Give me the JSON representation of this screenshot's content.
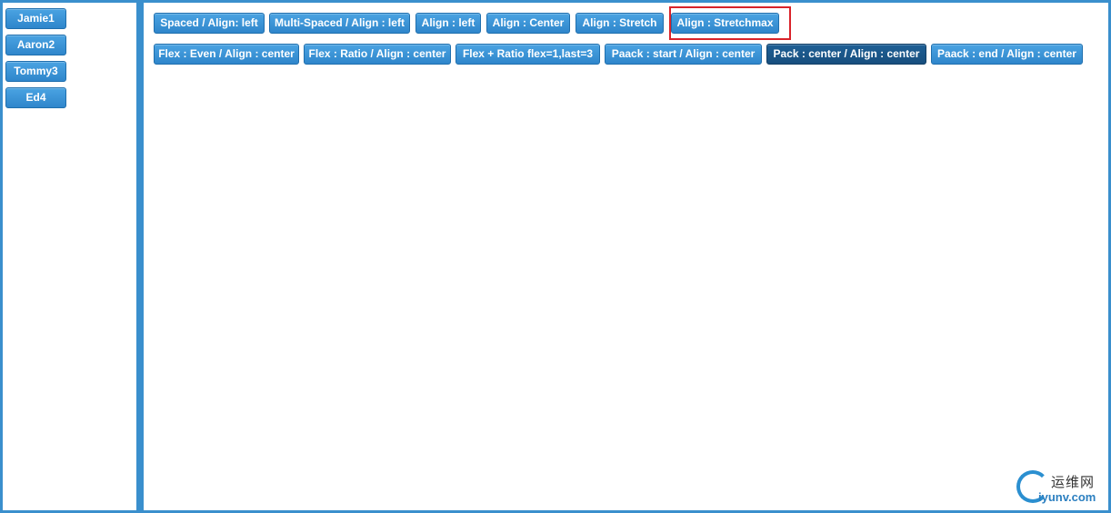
{
  "sidebar": {
    "items": [
      {
        "label": "Jamie1"
      },
      {
        "label": "Aaron2"
      },
      {
        "label": "Tommy3"
      },
      {
        "label": "Ed4"
      }
    ]
  },
  "toolbar_row1": {
    "buttons": [
      {
        "label": "Spaced / Align: left"
      },
      {
        "label": "Multi-Spaced / Align : left"
      },
      {
        "label": "Align : left"
      },
      {
        "label": "Align : Center"
      },
      {
        "label": "Align : Stretch"
      },
      {
        "label": "Align : Stretchmax"
      }
    ]
  },
  "toolbar_row2": {
    "buttons": [
      {
        "label": "Flex : Even / Align : center"
      },
      {
        "label": "Flex : Ratio / Align : center"
      },
      {
        "label": "Flex + Ratio flex=1,last=3"
      },
      {
        "label": "Paack : start / Align : center"
      },
      {
        "label": "Pack : center / Align : center",
        "pressed": true
      },
      {
        "label": "Paack : end / Align : center"
      }
    ]
  },
  "watermark": {
    "cn_text": "运维网",
    "en_text": "iyunv.com"
  },
  "colors": {
    "frame": "#3a8fcd",
    "button": "#2f86cb",
    "button_pressed": "#1e5f95",
    "highlight": "#d9232a"
  }
}
